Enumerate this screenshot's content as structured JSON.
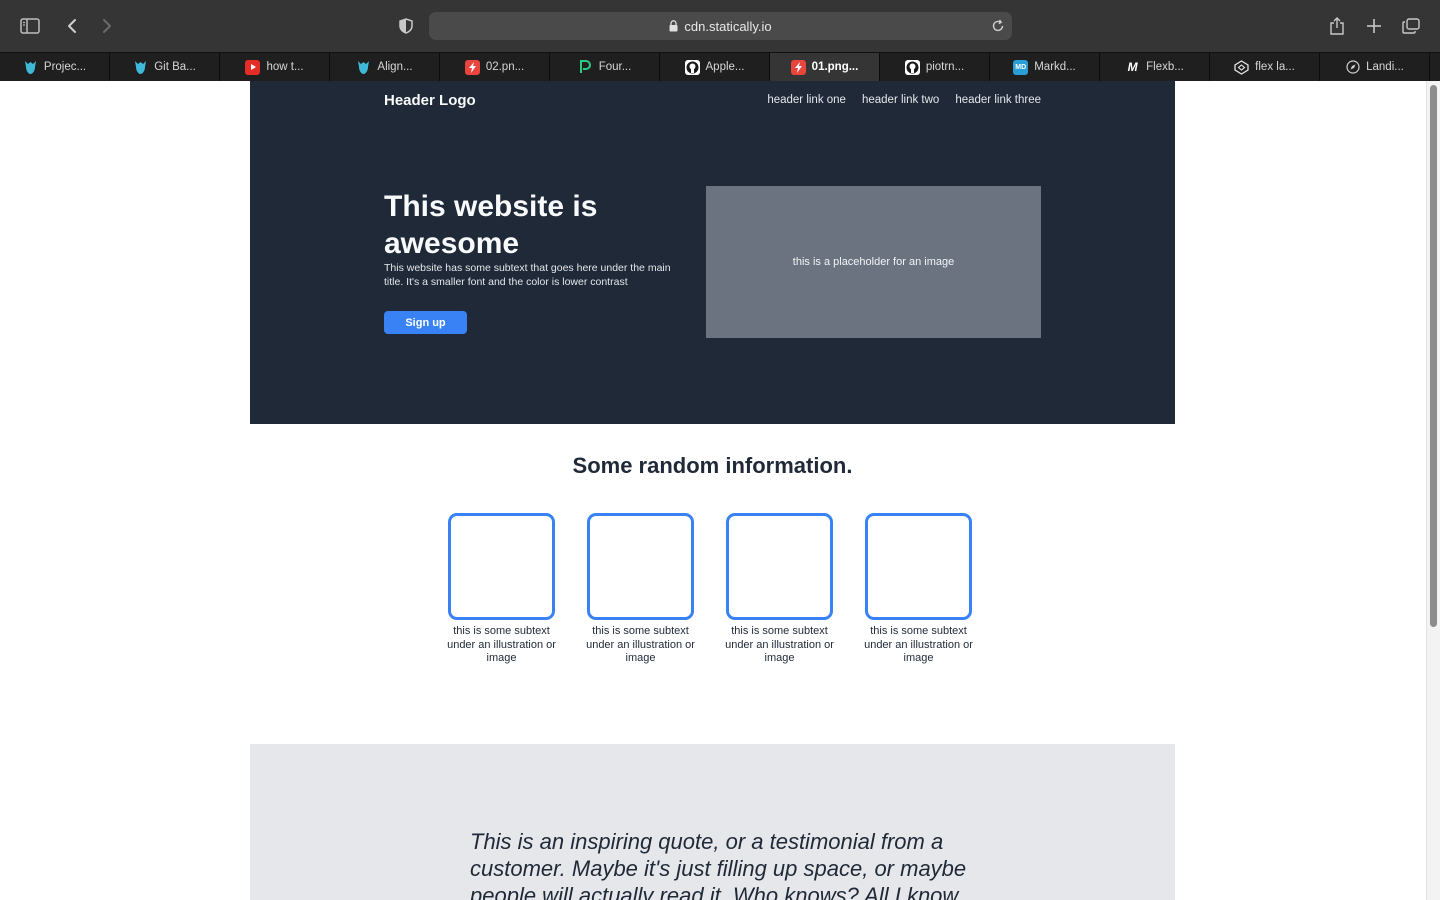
{
  "browser": {
    "url": "cdn.statically.io",
    "tabs": [
      {
        "label": "Projec...",
        "icon": "odin-icon",
        "active": false
      },
      {
        "label": "Git Ba...",
        "icon": "odin-icon",
        "active": false
      },
      {
        "label": "how t...",
        "icon": "youtube-icon",
        "active": false
      },
      {
        "label": "Align...",
        "icon": "odin-icon",
        "active": false
      },
      {
        "label": "02.pn...",
        "icon": "statically-icon",
        "active": false
      },
      {
        "label": "Four...",
        "icon": "pluralsight-icon",
        "active": false
      },
      {
        "label": "Apple...",
        "icon": "github-icon",
        "active": false
      },
      {
        "label": "01.png...",
        "icon": "statically-icon",
        "active": true
      },
      {
        "label": "piotrn...",
        "icon": "github-icon",
        "active": false
      },
      {
        "label": "Markd...",
        "icon": "markdown-icon",
        "active": false
      },
      {
        "label": "Flexb...",
        "icon": "medium-icon",
        "active": false
      },
      {
        "label": "flex la...",
        "icon": "codepen-icon",
        "active": false
      },
      {
        "label": "Landi...",
        "icon": "compass-icon",
        "active": false
      }
    ]
  },
  "page": {
    "header": {
      "logo": "Header Logo",
      "links": [
        "header link one",
        "header link two",
        "header link three"
      ]
    },
    "hero": {
      "title": "This website is awesome",
      "subtitle": "This website has some subtext that goes here under the main title.  It's a smaller font and the color is lower contrast",
      "button": "Sign up",
      "image_placeholder": "this is a placeholder for an image"
    },
    "info": {
      "title": "Some random information.",
      "cards": [
        {
          "text": "this is some subtext under an illustration or image"
        },
        {
          "text": "this is some subtext under an illustration or image"
        },
        {
          "text": "this is some subtext under an illustration or image"
        },
        {
          "text": "this is some subtext under an illustration or image"
        }
      ]
    },
    "quote": {
      "text": "This is an inspiring quote, or a testimonial from a customer.  Maybe it's just filling up space, or maybe people will actually read it. Who knows?  All I know"
    }
  },
  "colors": {
    "hero_bg": "#1f2937",
    "accent": "#3882f6",
    "placeholder_bg": "#6b7280",
    "quote_bg": "#e5e7eb"
  }
}
